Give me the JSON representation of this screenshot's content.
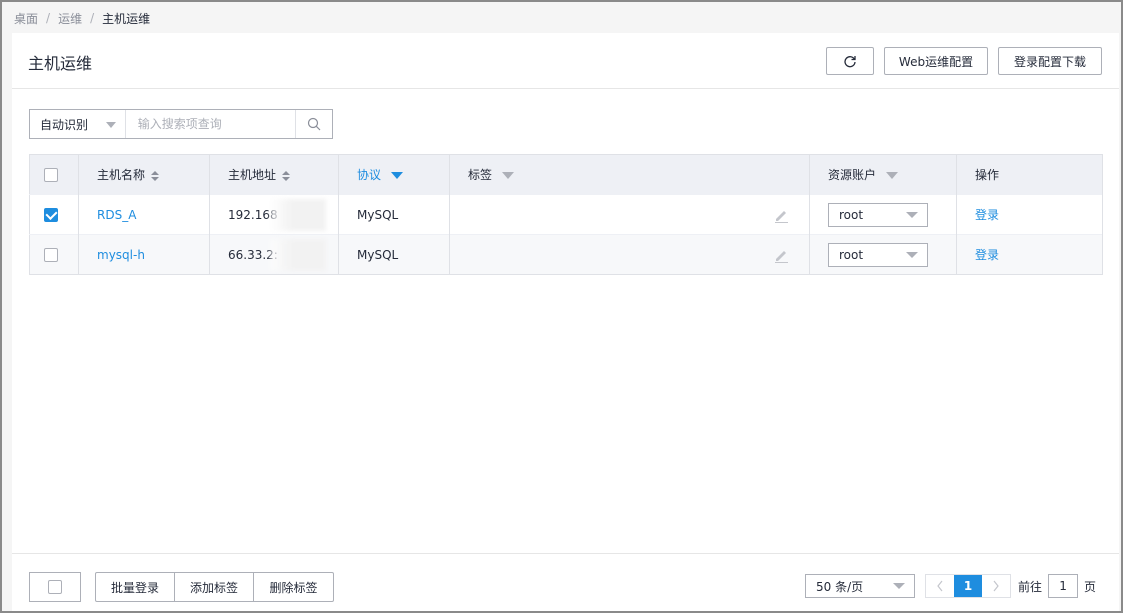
{
  "breadcrumb": {
    "items": [
      "桌面",
      "运维"
    ],
    "separator": "/",
    "current": "主机运维"
  },
  "header": {
    "title": "主机运维",
    "buttons": {
      "web_config": "Web运维配置",
      "login_config_download": "登录配置下载"
    }
  },
  "search": {
    "filter_selected": "自动识别",
    "placeholder": "输入搜索项查询"
  },
  "table": {
    "columns": {
      "host_name": "主机名称",
      "host_address": "主机地址",
      "protocol": "协议",
      "tags": "标签",
      "resource_account": "资源账户",
      "actions": "操作"
    },
    "rows": [
      {
        "checked": true,
        "host_name": "RDS_A",
        "host_address": "192.168",
        "protocol": "MySQL",
        "tags": "",
        "account": "root",
        "action": "登录"
      },
      {
        "checked": false,
        "host_name": "mysql-h",
        "host_address": "66.33.2:",
        "protocol": "MySQL",
        "tags": "",
        "account": "root",
        "action": "登录"
      }
    ]
  },
  "footer": {
    "bulk_buttons": {
      "batch_login": "批量登录",
      "add_tag": "添加标签",
      "delete_tag": "删除标签"
    },
    "page_size": "50 条/页",
    "current_page": "1",
    "goto_prefix": "前往",
    "goto_value": "1",
    "goto_suffix": "页"
  },
  "colors": {
    "accent": "#1e8ddf",
    "border": "#adb0b8",
    "header_bg": "#eef0f5"
  }
}
